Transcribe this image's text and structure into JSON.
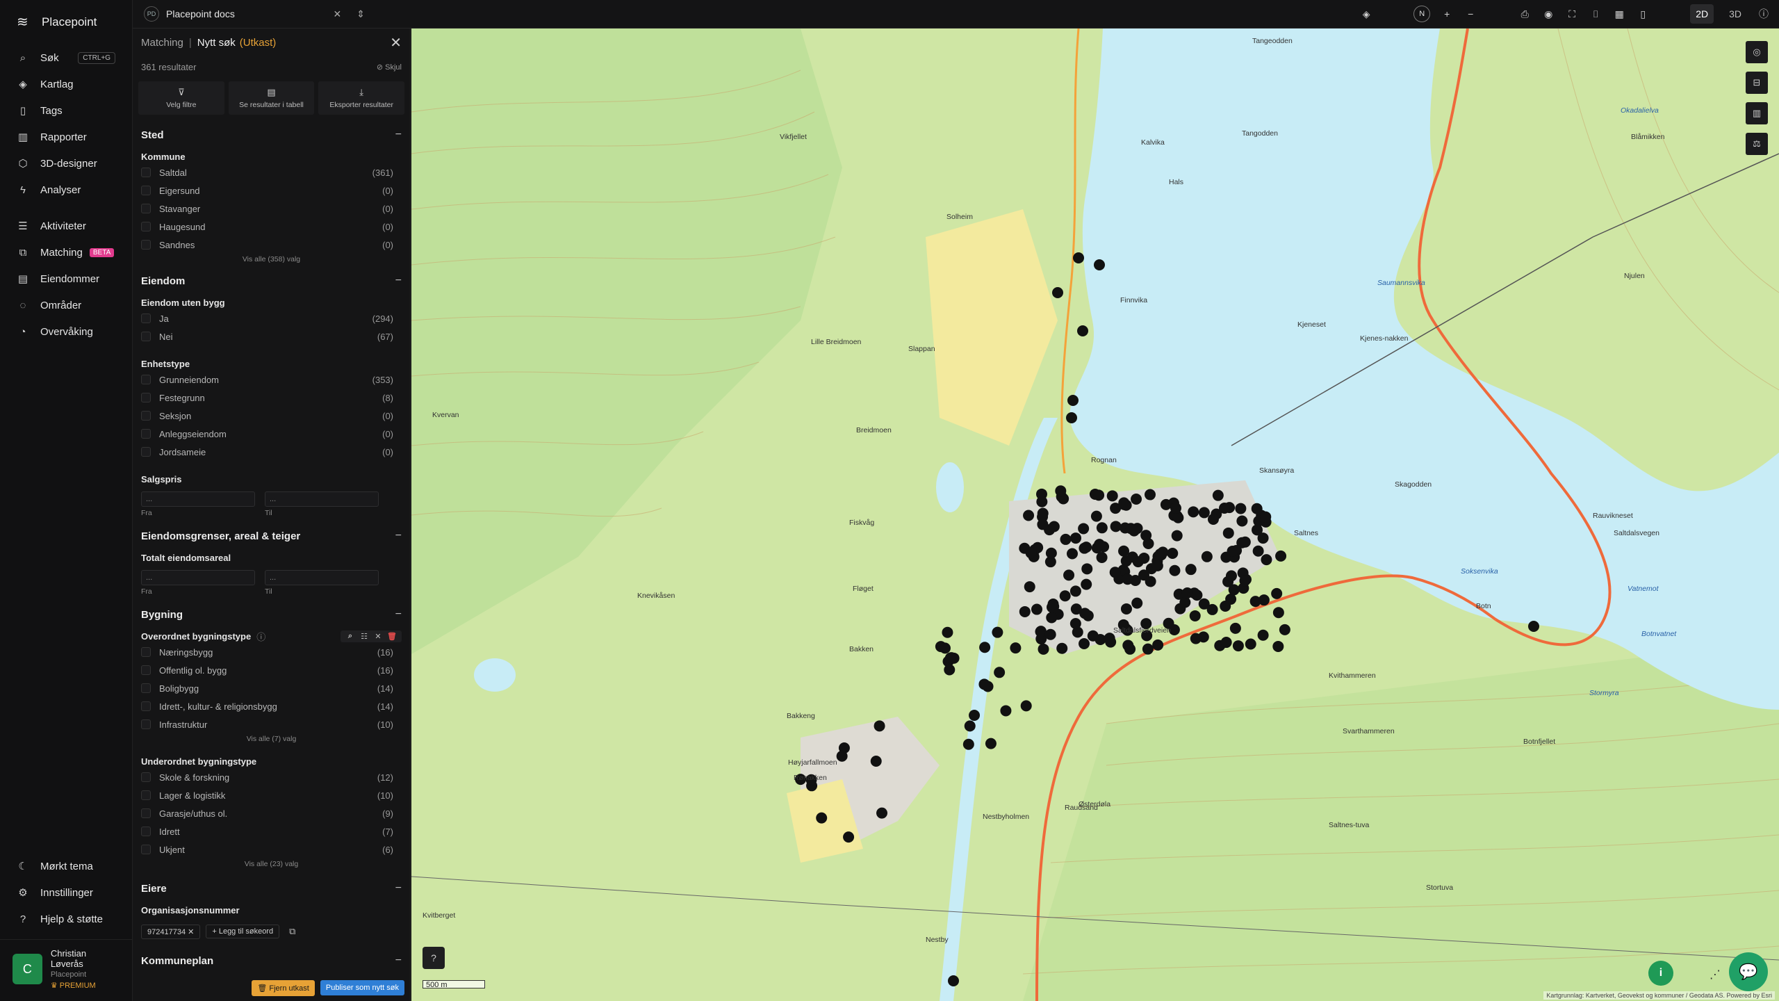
{
  "app": {
    "brand": "Placepoint",
    "workspace_badge": "PD",
    "workspace": "Placepoint docs"
  },
  "nav": {
    "items": [
      {
        "label": "Søk",
        "icon": "search-icon",
        "shortcut": "CTRL+G"
      },
      {
        "label": "Kartlag",
        "icon": "layers-icon"
      },
      {
        "label": "Tags",
        "icon": "bookmark-icon"
      },
      {
        "label": "Rapporter",
        "icon": "chart-icon"
      },
      {
        "label": "3D-designer",
        "icon": "cube-icon"
      },
      {
        "label": "Analyser",
        "icon": "bolt-icon"
      },
      {
        "label": "Aktiviteter",
        "icon": "activity-icon"
      },
      {
        "label": "Matching",
        "icon": "matching-icon",
        "badge": "BETA"
      },
      {
        "label": "Eiendommer",
        "icon": "property-icon"
      },
      {
        "label": "Områder",
        "icon": "area-icon"
      },
      {
        "label": "Overvåking",
        "icon": "monitor-icon"
      }
    ],
    "bottom": [
      {
        "label": "Mørkt tema",
        "icon": "moon-icon"
      },
      {
        "label": "Innstillinger",
        "icon": "gear-icon"
      },
      {
        "label": "Hjelp & støtte",
        "icon": "help-icon"
      }
    ],
    "user": {
      "initial": "C",
      "name": "Christian Løverås",
      "org": "Placepoint",
      "plan": "PREMIUM"
    }
  },
  "topbar": {
    "compass": "N",
    "mode_2d": "2D",
    "mode_3d": "3D"
  },
  "panel": {
    "crumb": "Matching",
    "sep": "|",
    "title": "Nytt søk",
    "draft": "(Utkast)",
    "results": "361 resultater",
    "hide": "Skjul",
    "actions": [
      {
        "label": "Velg filtre",
        "icon": "filter-icon"
      },
      {
        "label": "Se resultater i tabell",
        "icon": "table-icon"
      },
      {
        "label": "Eksporter resultater",
        "icon": "download-icon"
      }
    ],
    "sted": {
      "title": "Sted",
      "kommune_title": "Kommune",
      "kommune": [
        {
          "label": "Saltdal",
          "count": "(361)"
        },
        {
          "label": "Eigersund",
          "count": "(0)"
        },
        {
          "label": "Stavanger",
          "count": "(0)"
        },
        {
          "label": "Haugesund",
          "count": "(0)"
        },
        {
          "label": "Sandnes",
          "count": "(0)"
        }
      ],
      "kommune_more": "Vis alle (358) valg"
    },
    "eiendom": {
      "title": "Eiendom",
      "uten_bygg_title": "Eiendom uten bygg",
      "uten_bygg": [
        {
          "label": "Ja",
          "count": "(294)"
        },
        {
          "label": "Nei",
          "count": "(67)"
        }
      ],
      "enhetstype_title": "Enhetstype",
      "enhetstype": [
        {
          "label": "Grunneiendom",
          "count": "(353)"
        },
        {
          "label": "Festegrunn",
          "count": "(8)"
        },
        {
          "label": "Seksjon",
          "count": "(0)"
        },
        {
          "label": "Anleggseiendom",
          "count": "(0)"
        },
        {
          "label": "Jordsameie",
          "count": "(0)"
        }
      ],
      "salgspris_title": "Salgspris",
      "from_label": "Fra",
      "to_label": "Til",
      "from_placeholder": "...",
      "to_placeholder": "..."
    },
    "grenser": {
      "title": "Eiendomsgrenser, areal & teiger",
      "areal_title": "Totalt eiendomsareal",
      "from_label": "Fra",
      "to_label": "Til",
      "from_placeholder": "...",
      "to_placeholder": "..."
    },
    "bygning": {
      "title": "Bygning",
      "overordnet_title": "Overordnet bygningstype",
      "overordnet": [
        {
          "label": "Næringsbygg",
          "count": "(16)"
        },
        {
          "label": "Offentlig ol. bygg",
          "count": "(16)"
        },
        {
          "label": "Boligbygg",
          "count": "(14)"
        },
        {
          "label": "Idrett-, kultur- & religionsbygg",
          "count": "(14)"
        },
        {
          "label": "Infrastruktur",
          "count": "(10)"
        }
      ],
      "overordnet_more": "Vis alle (7) valg",
      "underordnet_title": "Underordnet bygningstype",
      "underordnet": [
        {
          "label": "Skole & forskning",
          "count": "(12)"
        },
        {
          "label": "Lager & logistikk",
          "count": "(10)"
        },
        {
          "label": "Garasje/uthus ol.",
          "count": "(9)"
        },
        {
          "label": "Idrett",
          "count": "(7)"
        },
        {
          "label": "Ukjent",
          "count": "(6)"
        }
      ],
      "underordnet_more": "Vis alle (23) valg"
    },
    "eiere": {
      "title": "Eiere",
      "org_title": "Organisasjonsnummer",
      "org_value": "972417734",
      "add_keyword": "Legg til søkeord"
    },
    "kommuneplan": {
      "title": "Kommuneplan"
    },
    "remove_draft": "Fjern utkast",
    "publish": "Publiser som nytt søk"
  },
  "map": {
    "scale": "500 m",
    "attribution": "Kartgrunnlag: Kartverket, Geovekst og kommuner / Geodata AS. Powered by Esri",
    "places": [
      {
        "name": "Tangeodden"
      },
      {
        "name": "Vikfjellet"
      },
      {
        "name": "Tangodden"
      },
      {
        "name": "Kalvika"
      },
      {
        "name": "Hals"
      },
      {
        "name": "Solheim"
      },
      {
        "name": "Finnvika"
      },
      {
        "name": "Saumannsvika"
      },
      {
        "name": "Kjeneset"
      },
      {
        "name": "Lille Breidmoen"
      },
      {
        "name": "Rognan"
      },
      {
        "name": "Skansøyra"
      },
      {
        "name": "Fiskvåg"
      },
      {
        "name": "Saltnes"
      },
      {
        "name": "Soksenvika"
      },
      {
        "name": "Botn"
      },
      {
        "name": "Bakken"
      },
      {
        "name": "Bakkeng"
      },
      {
        "name": "Høyjarfallmoen"
      },
      {
        "name": "Rønakken"
      },
      {
        "name": "Kvithammeren"
      },
      {
        "name": "Svarthammeren"
      },
      {
        "name": "Nestbyholmen"
      },
      {
        "name": "Saltdalsfjordveien"
      },
      {
        "name": "Saltdalsvegen"
      },
      {
        "name": "Østerdøla"
      },
      {
        "name": "Kvitberget"
      },
      {
        "name": "Nestby"
      },
      {
        "name": "Stortuva"
      },
      {
        "name": "Botnfjellet"
      },
      {
        "name": "Rauvikneset"
      },
      {
        "name": "Vatnemot"
      },
      {
        "name": "Botnvatnet"
      },
      {
        "name": "Stormyra"
      },
      {
        "name": "Okadalielva"
      },
      {
        "name": "Blåmikken"
      },
      {
        "name": "Njulen"
      },
      {
        "name": "Kjenes-nakken"
      },
      {
        "name": "Skagodden"
      },
      {
        "name": "Kvervan"
      },
      {
        "name": "Breidmoen"
      },
      {
        "name": "Slappan"
      },
      {
        "name": "Saltnes-tuva"
      },
      {
        "name": "Raudsand"
      },
      {
        "name": "Fløget"
      },
      {
        "name": "Knevikåsen"
      }
    ]
  }
}
